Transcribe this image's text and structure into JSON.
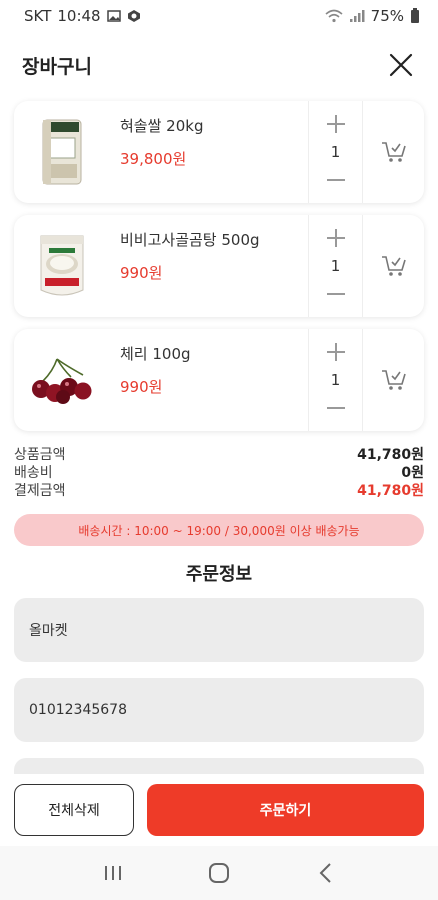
{
  "status_bar": {
    "carrier": "SKT",
    "time": "10:48",
    "battery": "75%",
    "icons": [
      "gallery-icon",
      "app-icon",
      "wifi-icon",
      "signal-icon",
      "battery-icon"
    ]
  },
  "header": {
    "title": "장바구니",
    "close_icon": "close-icon"
  },
  "cart": {
    "items": [
      {
        "name": "혀솔쌀  20kg",
        "price": "39,800원",
        "quantity": "1",
        "thumb": "rice-bag-image"
      },
      {
        "name": "비비고사골곰탕 500g",
        "price": "990원",
        "quantity": "1",
        "thumb": "soup-pouch-image"
      },
      {
        "name": "체리 100g",
        "price": "990원",
        "quantity": "1",
        "thumb": "cherry-image"
      }
    ]
  },
  "summary": {
    "subtotal_label": "상품금액",
    "subtotal_value": "41,780원",
    "shipping_label": "배송비",
    "shipping_value": "0원",
    "total_label": "결제금액",
    "total_value": "41,780원"
  },
  "delivery_notice": "배송시간 : 10:00 ~ 19:00 / 30,000원 이상 배송가능",
  "order_info": {
    "title": "주문정보",
    "name_value": "올마켓",
    "phone_value": "01012345678",
    "address_value": ""
  },
  "actions": {
    "delete_all": "전체삭제",
    "order": "주문하기"
  },
  "colors": {
    "accent": "#ee3b28",
    "price": "#e63b2e",
    "banner_bg": "#f9c9cb",
    "field_bg": "#ececec"
  }
}
